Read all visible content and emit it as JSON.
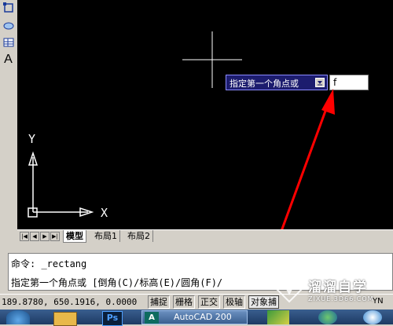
{
  "toolbar": {
    "icons": [
      "rectangle-tool-icon",
      "region-icon",
      "table-icon",
      "text-icon"
    ],
    "text_tool_label": "A"
  },
  "canvas": {
    "tooltip_prompt": "指定第一个角点或",
    "input_value": "f",
    "ucs_y_label": "Y",
    "ucs_x_label": "X"
  },
  "layout_tabs": {
    "nav": [
      "|◀",
      "◀",
      "▶",
      "▶|"
    ],
    "tabs": [
      "模型",
      "布局1",
      "布局2"
    ]
  },
  "command": {
    "line1": "命令: _rectang",
    "line2": "指定第一个角点或 [倒角(C)/标高(E)/圆角(F)/"
  },
  "status": {
    "coords": "189.8780, 650.1916, 0.0000",
    "buttons": [
      "捕捉",
      "栅格",
      "正交",
      "极轴",
      "对象捕"
    ],
    "right_text": "YN"
  },
  "taskbar": {
    "autocad_label": "AutoCAD 200",
    "ps_label": "Ps"
  },
  "watermark": {
    "name": "溜溜自学",
    "url": "ZIXUE.3D66.COM"
  },
  "colors": {
    "canvas_bg": "#000000",
    "tooltip_bg": "#1c1c6e",
    "arrow_red": "#ff0000",
    "ucs_white": "#ffffff"
  }
}
